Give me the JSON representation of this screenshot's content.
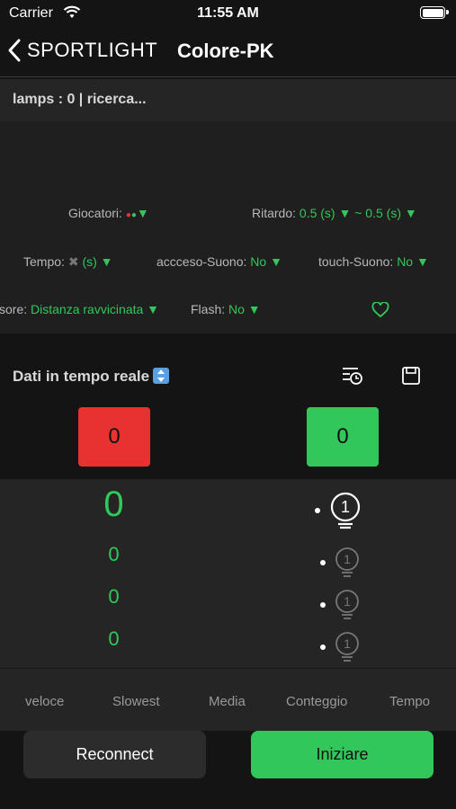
{
  "status_bar": {
    "carrier": "Carrier",
    "time": "11:55 AM"
  },
  "nav": {
    "back_label": "SPORTLIGHT",
    "title": "Colore-PK"
  },
  "lamps_status": "lamps : 0 | ricerca...",
  "settings": {
    "players_label": "Giocatori:",
    "players_value": "▼",
    "delay_label": "Ritardo:",
    "delay_value": "0.5 (s) ▼ ~ 0.5 (s) ▼",
    "time_label": "Tempo:",
    "time_x": "✖",
    "time_value": "(s) ▼",
    "sound_on_label": "accceso-Suono:",
    "sound_on_value": "No ▼",
    "touch_sound_label": "touch-Suono:",
    "touch_sound_value": "No ▼",
    "sensor_label": "sore:",
    "sensor_value": "Distanza ravvicinata ▼",
    "flash_label": "Flash:",
    "flash_value": "No ▼"
  },
  "realtime": {
    "title": "Dati in tempo reale",
    "red_score": "0",
    "green_score": "0"
  },
  "results": {
    "main_value": "0",
    "values": [
      "0",
      "0",
      "0"
    ],
    "bulb_labels": [
      "1",
      "1",
      "1",
      "1"
    ]
  },
  "tabs": [
    "veloce",
    "Slowest",
    "Media",
    "Conteggio",
    "Tempo"
  ],
  "buttons": {
    "reconnect": "Reconnect",
    "start": "Iniziare"
  },
  "colors": {
    "accent_green": "#32c75a",
    "accent_red": "#e83232"
  }
}
